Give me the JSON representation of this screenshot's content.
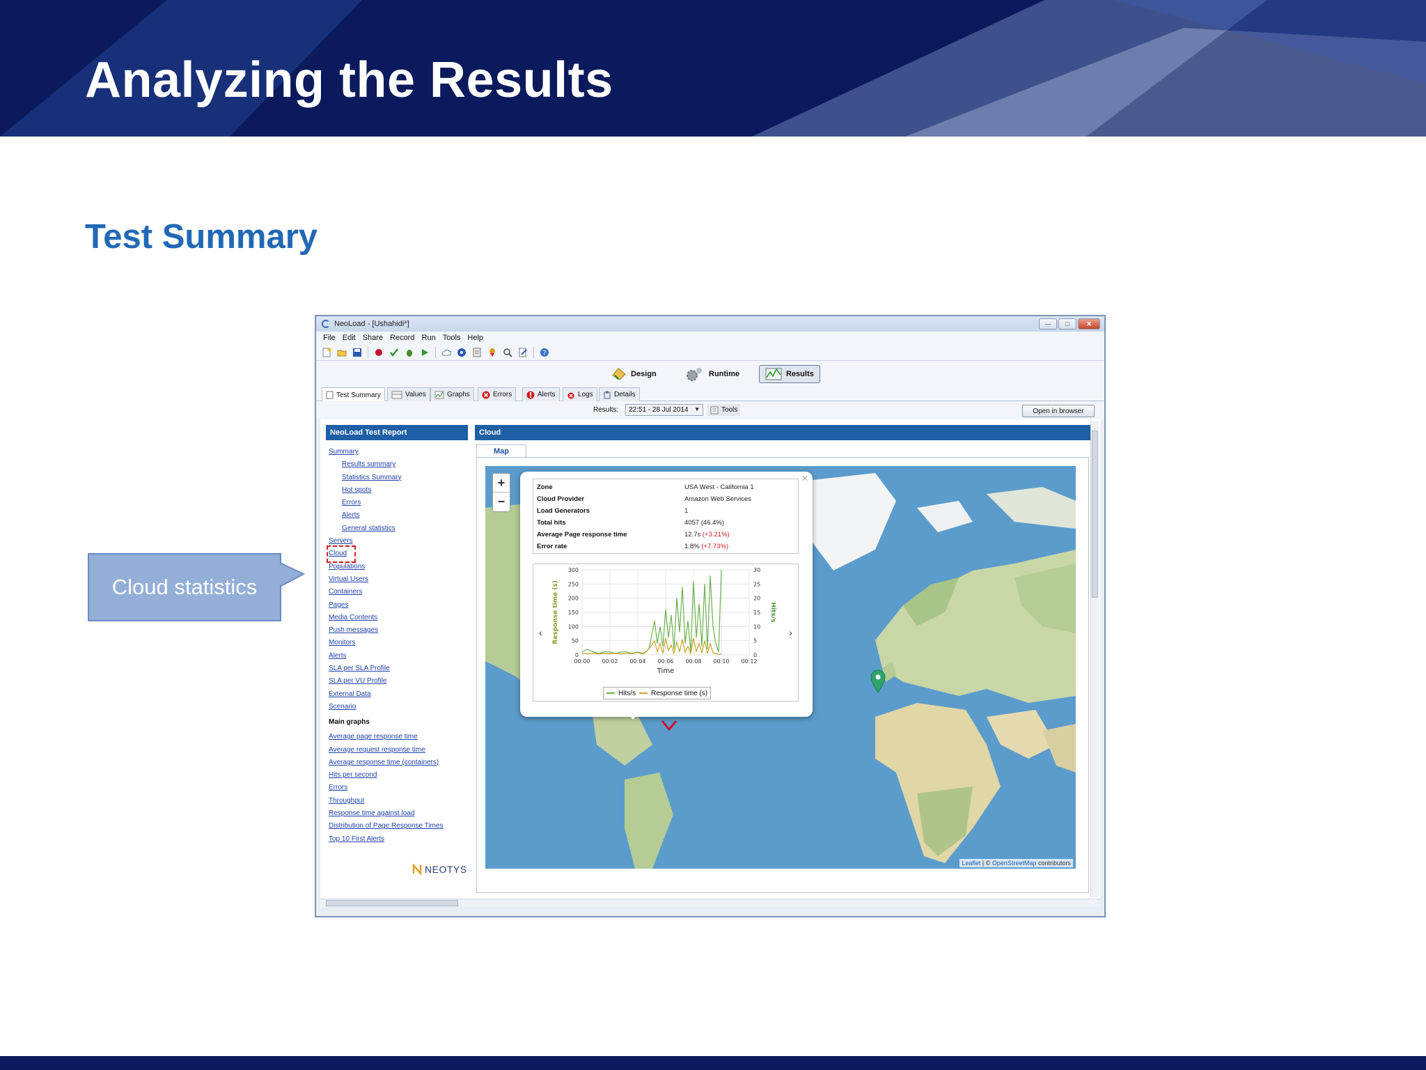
{
  "slide": {
    "title": "Analyzing the Results",
    "subtitle": "Test Summary",
    "callout": "Cloud statistics"
  },
  "window": {
    "title": "NeoLoad - [Ushahidi*]",
    "menu": [
      "File",
      "Edit",
      "Share",
      "Record",
      "Run",
      "Tools",
      "Help"
    ],
    "modes": [
      {
        "label": "Design",
        "active": false
      },
      {
        "label": "Runtime",
        "active": false
      },
      {
        "label": "Results",
        "active": true
      }
    ],
    "tabs": [
      "Test Summary",
      "Values",
      "Graphs",
      "Errors",
      "Alerts",
      "Logs",
      "Details"
    ],
    "results_label": "Results:",
    "results_value": "22:51 - 28 Jul 2014",
    "tools_label": "Tools",
    "open_in_browser": "Open in browser"
  },
  "sidebar": {
    "header": "NeoLoad Test Report",
    "links": [
      {
        "label": "Summary",
        "sub": false
      },
      {
        "label": "Results summary",
        "sub": true
      },
      {
        "label": "Statistics Summary",
        "sub": true
      },
      {
        "label": "Hot spots",
        "sub": true
      },
      {
        "label": "Errors",
        "sub": true
      },
      {
        "label": "Alerts",
        "sub": true
      },
      {
        "label": "General statistics",
        "sub": true
      },
      {
        "label": "Servers",
        "sub": false
      },
      {
        "label": "Cloud",
        "sub": false
      },
      {
        "label": "Populations",
        "sub": false
      },
      {
        "label": "Virtual Users",
        "sub": false
      },
      {
        "label": "Containers",
        "sub": false
      },
      {
        "label": "Pages",
        "sub": false
      },
      {
        "label": "Media Contents",
        "sub": false
      },
      {
        "label": "Push messages",
        "sub": false
      },
      {
        "label": "Monitors",
        "sub": false
      },
      {
        "label": "Alerts",
        "sub": false
      },
      {
        "label": "SLA per SLA Profile",
        "sub": false
      },
      {
        "label": "SLA per VU Profile",
        "sub": false
      },
      {
        "label": "External Data",
        "sub": false
      },
      {
        "label": "Scenario",
        "sub": false
      }
    ],
    "main_graphs_title": "Main graphs",
    "main_graphs": [
      "Average page response time",
      "Average request response time",
      "Average response time (containers)",
      "Hits per second",
      "Errors",
      "Throughput",
      "Response time against load",
      "Distribution of Page Response Times",
      "Top 10 First Alerts"
    ],
    "brand": "NEOTYS"
  },
  "main": {
    "header": "Cloud",
    "tab": "Map",
    "attribution": {
      "leaflet": "Leaflet",
      "osm": "OpenStreetMap",
      "rest": "contributors"
    },
    "popup": {
      "rows": [
        {
          "key": "Zone",
          "value": "USA West - California 1",
          "delta": ""
        },
        {
          "key": "Cloud Provider",
          "value": "Amazon Web Services",
          "delta": ""
        },
        {
          "key": "Load Generators",
          "value": "1",
          "delta": ""
        },
        {
          "key": "Total hits",
          "value": "4057 (46.4%)",
          "delta": ""
        },
        {
          "key": "Average Page response time",
          "value": "12.7s",
          "delta": "(+3.21%)"
        },
        {
          "key": "Error rate",
          "value": "1.8%",
          "delta": "(+7.73%)"
        }
      ]
    }
  },
  "chart_data": {
    "type": "line",
    "xlabel": "Time",
    "ylabel": "Response time (s)",
    "y2label": "Hits/s",
    "x_ticks": [
      "00:00",
      "00:02",
      "00:04",
      "00:06",
      "00:08",
      "00:10",
      "00:12"
    ],
    "ylim": [
      0,
      300
    ],
    "y_ticks": [
      0,
      50,
      100,
      150,
      200,
      250,
      300
    ],
    "y2lim": [
      0,
      30
    ],
    "y2_ticks": [
      0,
      5,
      10,
      15,
      20,
      25,
      30
    ],
    "x_minutes": [
      0,
      0.4,
      0.8,
      1.2,
      1.6,
      2.0,
      2.4,
      2.8,
      3.2,
      3.6,
      4.0,
      4.4,
      4.8,
      5.2,
      5.4,
      5.6,
      5.8,
      6.0,
      6.2,
      6.4,
      6.6,
      6.8,
      7.0,
      7.2,
      7.4,
      7.6,
      7.8,
      8.0,
      8.2,
      8.4,
      8.6,
      8.8,
      9.0,
      9.2,
      9.4,
      9.6,
      9.8,
      10.0
    ],
    "series": [
      {
        "name": "Hits/s",
        "axis": "right",
        "color": "#6ab04c",
        "values": [
          1,
          2,
          1,
          0.5,
          1,
          1,
          0.5,
          1,
          1,
          0.5,
          1,
          0.5,
          2,
          12,
          4,
          10,
          3,
          16,
          6,
          14,
          2,
          20,
          8,
          24,
          4,
          12,
          1,
          26,
          6,
          18,
          3,
          25,
          2,
          28,
          10,
          4,
          1,
          30
        ]
      },
      {
        "name": "Response time (s)",
        "axis": "left",
        "color": "#c9a227",
        "values": [
          5,
          4,
          6,
          3,
          5,
          4,
          6,
          3,
          5,
          4,
          8,
          3,
          20,
          50,
          10,
          40,
          5,
          60,
          15,
          35,
          5,
          45,
          10,
          55,
          8,
          30,
          5,
          60,
          12,
          40,
          6,
          50,
          5,
          40,
          8,
          4,
          2,
          3
        ]
      }
    ],
    "legend": "bottom"
  },
  "colors": {
    "header_bg": "#0a1a5c",
    "accent": "#2268b5",
    "panel_head": "#1f5fa6",
    "link": "#1c3fa8"
  }
}
